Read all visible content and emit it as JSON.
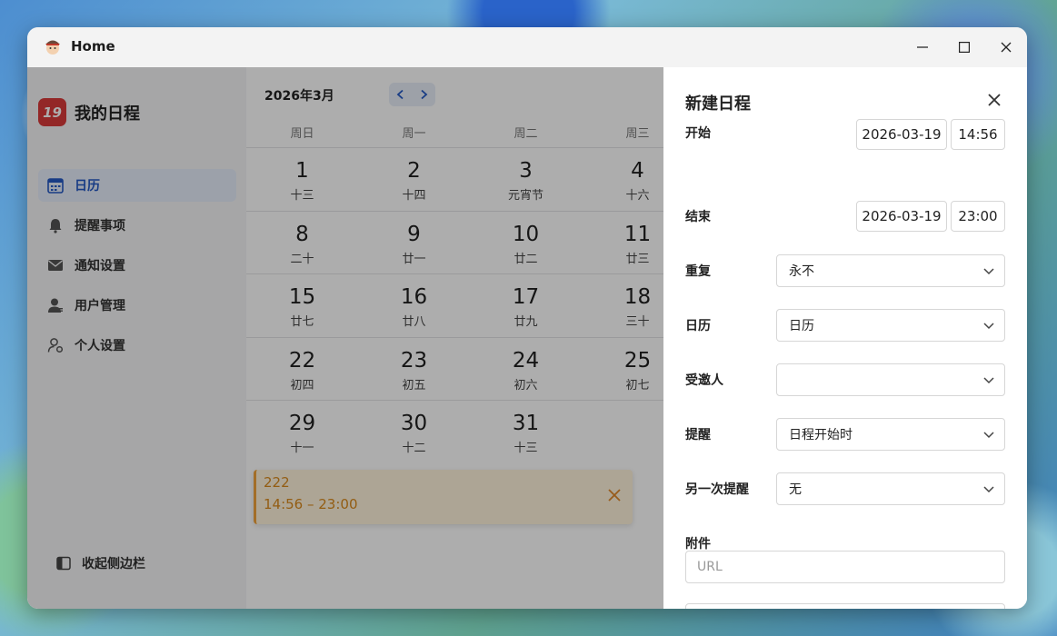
{
  "window": {
    "title": "Home"
  },
  "sidebar": {
    "brand_logo": "19",
    "brand_name": "我的日程",
    "items": [
      {
        "label": "日历",
        "icon": "calendar-icon",
        "active": true
      },
      {
        "label": "提醒事项",
        "icon": "bell-icon"
      },
      {
        "label": "通知设置",
        "icon": "mail-icon"
      },
      {
        "label": "用户管理",
        "icon": "user-manage-icon"
      },
      {
        "label": "个人设置",
        "icon": "user-settings-icon"
      }
    ],
    "collapse_label": "收起侧边栏"
  },
  "calendar": {
    "month_label": "2026年3月",
    "weekdays": [
      "周日",
      "周一",
      "周二",
      "周三"
    ],
    "weeks": [
      [
        {
          "num": "1",
          "lunar": "十三"
        },
        {
          "num": "2",
          "lunar": "十四"
        },
        {
          "num": "3",
          "lunar": "元宵节"
        },
        {
          "num": "4",
          "lunar": "十六"
        }
      ],
      [
        {
          "num": "8",
          "lunar": "二十"
        },
        {
          "num": "9",
          "lunar": "廿一"
        },
        {
          "num": "10",
          "lunar": "廿二"
        },
        {
          "num": "11",
          "lunar": "廿三"
        }
      ],
      [
        {
          "num": "15",
          "lunar": "廿七"
        },
        {
          "num": "16",
          "lunar": "廿八"
        },
        {
          "num": "17",
          "lunar": "廿九"
        },
        {
          "num": "18",
          "lunar": "三十"
        }
      ],
      [
        {
          "num": "22",
          "lunar": "初四"
        },
        {
          "num": "23",
          "lunar": "初五"
        },
        {
          "num": "24",
          "lunar": "初六"
        },
        {
          "num": "25",
          "lunar": "初七"
        }
      ],
      [
        {
          "num": "29",
          "lunar": "十一"
        },
        {
          "num": "30",
          "lunar": "十二"
        },
        {
          "num": "31",
          "lunar": "十三"
        },
        {
          "num": "",
          "lunar": ""
        }
      ]
    ],
    "event": {
      "title": "222",
      "time": "14:56 – 23:00"
    }
  },
  "panel": {
    "title": "新建日程",
    "start_label": "开始",
    "start_date": "2026-03-19",
    "start_time": "14:56",
    "end_label": "结束",
    "end_date": "2026-03-19",
    "end_time": "23:00",
    "repeat_label": "重复",
    "repeat_value": "永不",
    "calendar_label": "日历",
    "calendar_value": "日历",
    "invitees_label": "受邀人",
    "invitees_value": "",
    "reminder_label": "提醒",
    "reminder_value": "日程开始时",
    "second_reminder_label": "另一次提醒",
    "second_reminder_value": "无",
    "attachment_label": "附件",
    "url_placeholder": "URL"
  },
  "colors": {
    "accent": "#2459c4",
    "brand": "#d93a3a",
    "event": "#f0a23b"
  }
}
